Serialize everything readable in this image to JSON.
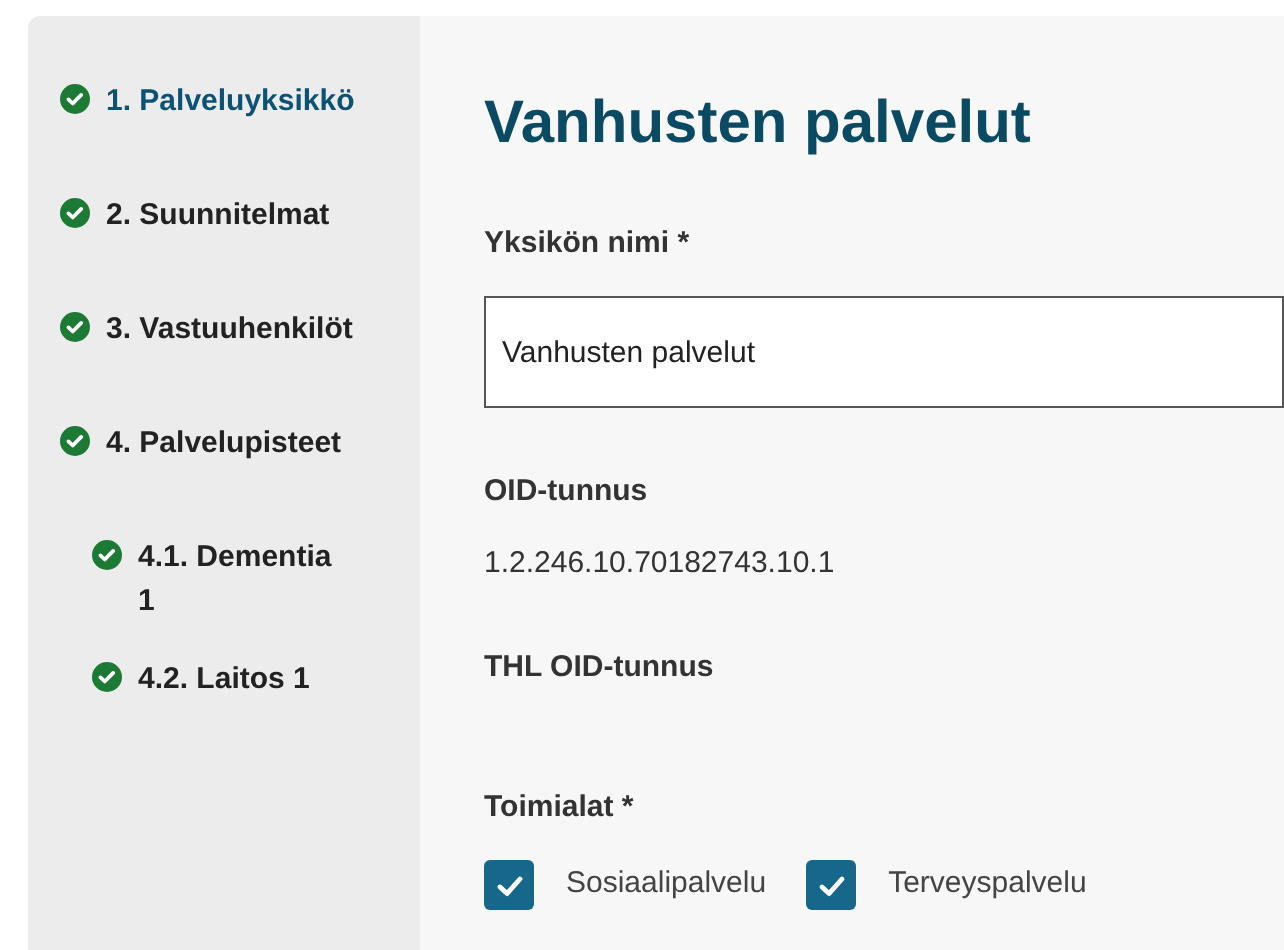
{
  "sidebar": {
    "items": [
      {
        "label": "1. Palveluyksikkö",
        "selected": true,
        "completed": true
      },
      {
        "label": "2. Suunnitelmat",
        "selected": false,
        "completed": true
      },
      {
        "label": "3. Vastuuhenkilöt",
        "selected": false,
        "completed": true
      },
      {
        "label": "4. Palvelupisteet",
        "selected": false,
        "completed": true,
        "children": [
          {
            "label": "4.1. Dementia 1",
            "selected": false,
            "completed": true
          },
          {
            "label": "4.2. Laitos 1",
            "selected": false,
            "completed": true
          }
        ]
      }
    ]
  },
  "main": {
    "title": "Vanhusten palvelut",
    "fields": [
      {
        "kind": "input",
        "label": "Yksikön nimi *",
        "value": "Vanhusten palvelut"
      },
      {
        "kind": "text",
        "label": "OID-tunnus",
        "value": "1.2.246.10.70182743.10.1"
      },
      {
        "kind": "text",
        "label": "THL OID-tunnus"
      },
      {
        "kind": "checkboxes",
        "label": "Toimialat *",
        "options": [
          {
            "label": "Sosiaalipalvelu",
            "checked": true
          },
          {
            "label": "Terveyspalvelu",
            "checked": true
          }
        ]
      }
    ]
  }
}
